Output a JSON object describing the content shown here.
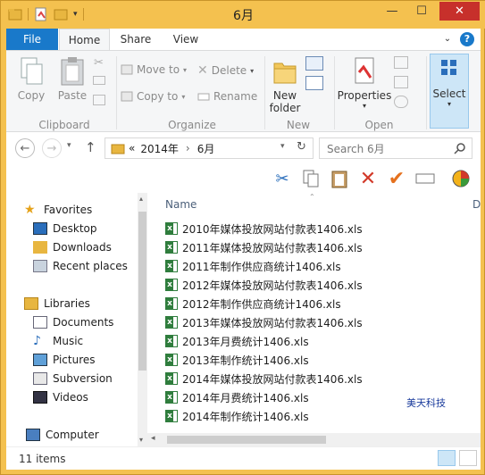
{
  "window": {
    "title": "6月",
    "close_glyph": "✕",
    "minimize_glyph": "—",
    "maximize_glyph": "☐"
  },
  "ribbon_tabs": {
    "file": "File",
    "home": "Home",
    "share": "Share",
    "view": "View"
  },
  "ribbon": {
    "clipboard": {
      "label": "Clipboard",
      "copy": "Copy",
      "paste": "Paste"
    },
    "organize": {
      "label": "Organize",
      "move_to": "Move to",
      "copy_to": "Copy to",
      "delete": "Delete",
      "rename": "Rename"
    },
    "new": {
      "label": "New",
      "new_folder_line1": "New",
      "new_folder_line2": "folder"
    },
    "open": {
      "label": "Open",
      "properties": "Properties"
    },
    "select": {
      "select": "Select"
    }
  },
  "address": {
    "prefix": "«",
    "crumb1": "2014年",
    "sep": "›",
    "crumb2": "6月"
  },
  "search": {
    "placeholder": "Search 6月"
  },
  "nav": {
    "favorites": "Favorites",
    "desktop": "Desktop",
    "downloads": "Downloads",
    "recent": "Recent places",
    "libraries": "Libraries",
    "documents": "Documents",
    "music": "Music",
    "pictures": "Pictures",
    "subversion": "Subversion",
    "videos": "Videos",
    "computer": "Computer"
  },
  "files": {
    "column_name": "Name",
    "column_date_partial": "D",
    "items": [
      "2010年媒体投放网站付款表1406.xls",
      "2011年媒体投放网站付款表1406.xls",
      "2011年制作供应商统计1406.xls",
      "2012年媒体投放网站付款表1406.xls",
      "2012年制作供应商统计1406.xls",
      "2013年媒体投放网站付款表1406.xls",
      "2013年月费统计1406.xls",
      "2013年制作统计1406.xls",
      "2014年媒体投放网站付款表1406.xls",
      "2014年月费统计1406.xls",
      "2014年制作统计1406.xls"
    ]
  },
  "watermark": "美天科技",
  "status": {
    "count": "11 items"
  },
  "colors": {
    "titlebar": "#f4c14f",
    "file_tab": "#1979ca",
    "close": "#c7302b",
    "excel": "#2f7d3d"
  }
}
